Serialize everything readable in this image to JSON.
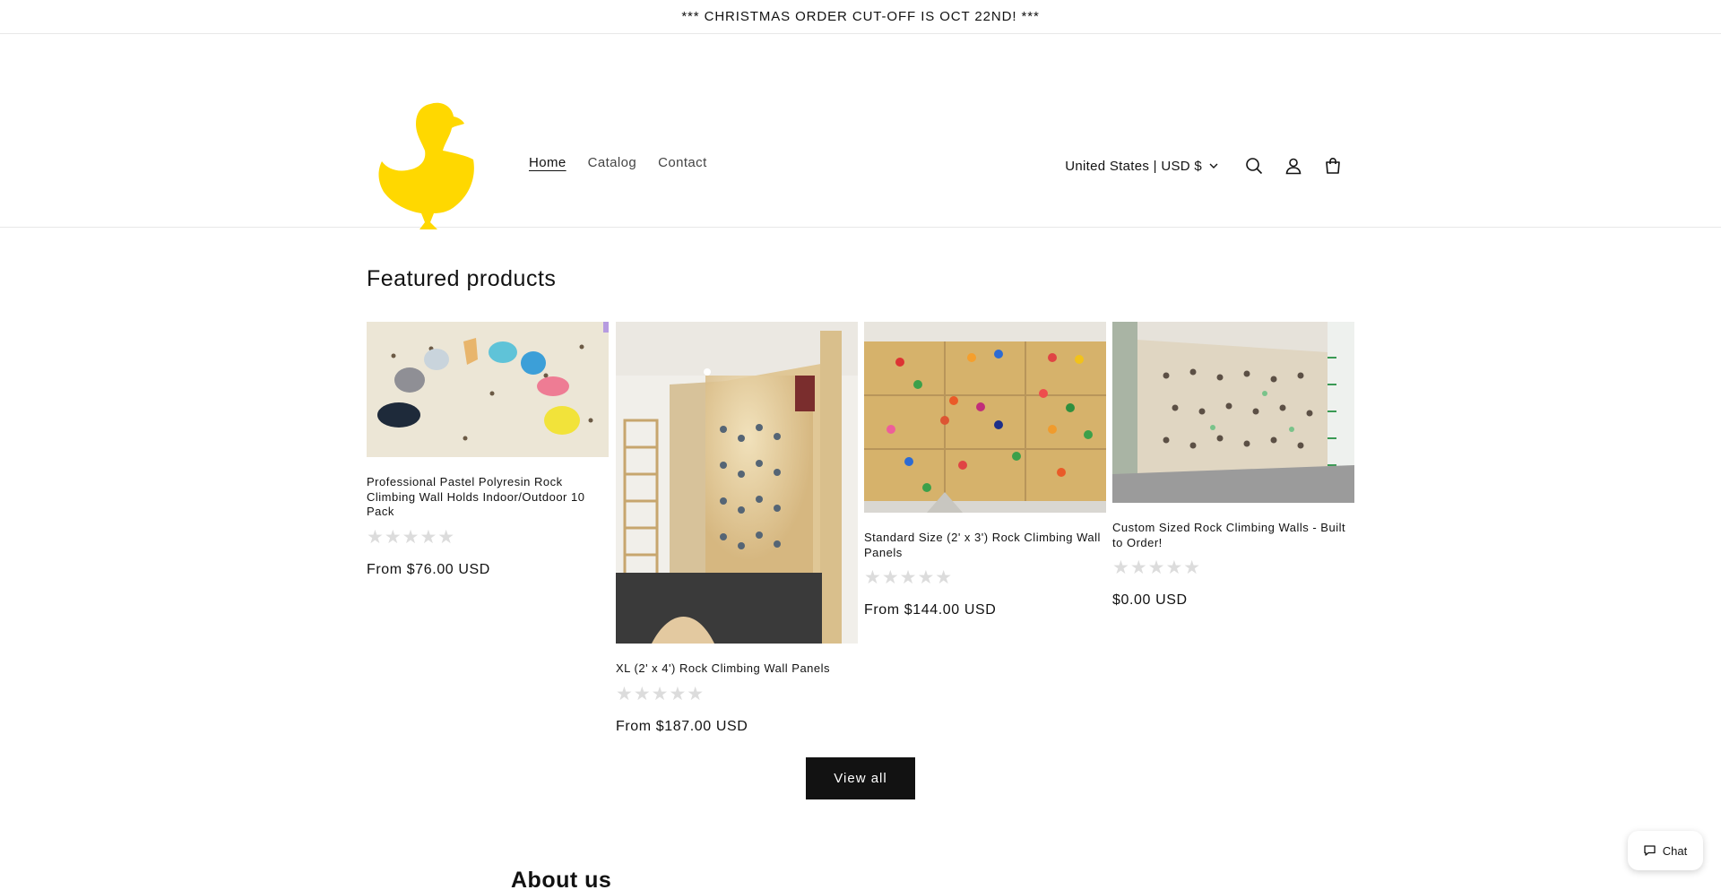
{
  "announcement": "*** CHRISTMAS ORDER CUT-OFF IS OCT 22ND! ***",
  "header": {
    "logo_icon": "yellow-duck-icon",
    "logo_color": "#FFD800",
    "nav": [
      {
        "label": "Home",
        "active": true
      },
      {
        "label": "Catalog",
        "active": false
      },
      {
        "label": "Contact",
        "active": false
      }
    ],
    "currency": "United States | USD $",
    "icons": [
      "search-icon",
      "account-icon",
      "cart-icon"
    ]
  },
  "featured": {
    "title": "Featured products",
    "products": [
      {
        "title": "Professional Pastel Polyresin Rock Climbing Wall Holds Indoor/Outdoor 10 Pack",
        "stars": "★★★★★",
        "rating": 0,
        "price": "From $76.00 USD"
      },
      {
        "title": "XL (2' x 4') Rock Climbing Wall Panels",
        "stars": "★★★★★",
        "rating": 0,
        "price": "From $187.00 USD"
      },
      {
        "title": "Standard Size (2' x 3') Rock Climbing Wall Panels",
        "stars": "★★★★★",
        "rating": 0,
        "price": "From $144.00 USD"
      },
      {
        "title": "Custom Sized Rock Climbing Walls - Built to Order!",
        "stars": "★★★★★",
        "rating": 0,
        "price": "$0.00 USD"
      }
    ],
    "view_all": "View all"
  },
  "about": {
    "title": "About us"
  },
  "chat": {
    "label": "Chat",
    "icon": "chat-bubble-icon"
  },
  "colors": {
    "accent": "#121212",
    "logo": "#FFD800",
    "star_empty": "#DCDCDC"
  }
}
